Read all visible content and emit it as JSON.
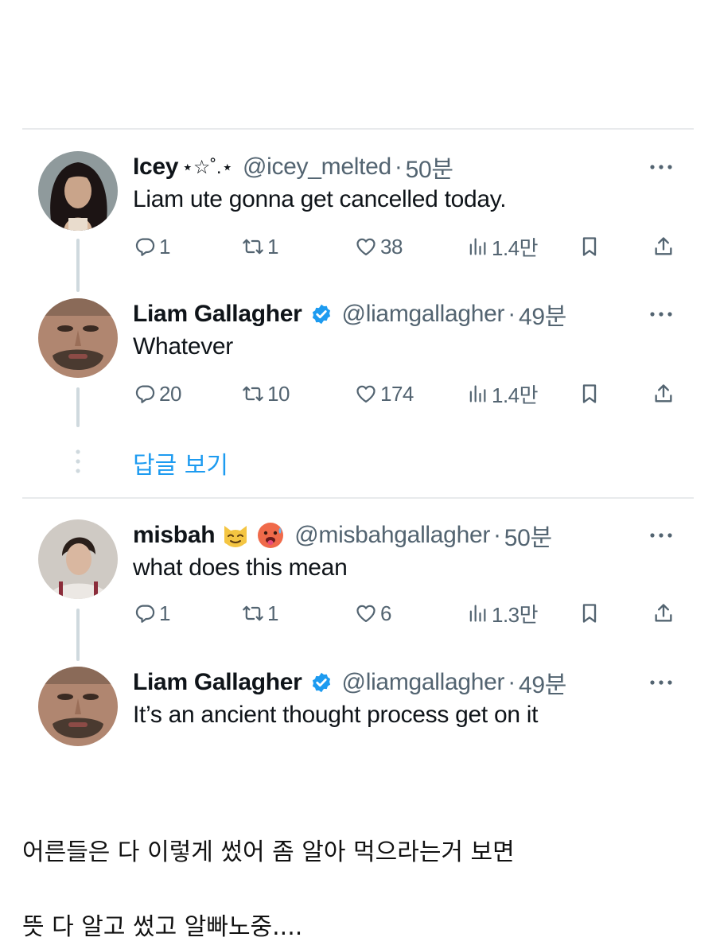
{
  "tweets": [
    {
      "name": "Icey",
      "name_deco": "⋆☆˚.⋆",
      "handle": "@icey_melted",
      "time": "50분",
      "text": "Liam ute gonna get cancelled today.",
      "replies": "1",
      "retweets": "1",
      "likes": "38",
      "views": "1.4만"
    },
    {
      "name": "Liam Gallagher",
      "handle": "@liamgallagher",
      "time": "49분",
      "text": "Whatever",
      "replies": "20",
      "retweets": "10",
      "likes": "174",
      "views": "1.4만"
    },
    {
      "name": "misbah",
      "handle": "@misbahgallagher",
      "time": "50분",
      "text": "what does this mean",
      "replies": "1",
      "retweets": "1",
      "likes": "6",
      "views": "1.3만"
    },
    {
      "name": "Liam Gallagher",
      "handle": "@liamgallagher",
      "time": "49분",
      "text": "It’s an ancient thought process get on it"
    }
  ],
  "view_replies": "답글 보기",
  "separator": "·",
  "comments": [
    "어른들은 다 이렇게 썼어 좀 알아 먹으라는거 보면",
    "뜻 다 알고 썼고 알빠노중...."
  ],
  "icons": {
    "reply": "reply-icon",
    "retweet": "retweet-icon",
    "like": "heart-icon",
    "views": "views-icon",
    "bookmark": "bookmark-icon",
    "share": "share-icon",
    "more": "more-icon",
    "verified": "verified-badge-icon",
    "emoji1": "cat-face-emoji",
    "emoji2": "hot-face-emoji"
  },
  "colors": {
    "accent": "#1d9bf0",
    "muted": "#536471",
    "text": "#0f1419",
    "divider": "#e8eaec",
    "thread": "#cfd9de"
  }
}
